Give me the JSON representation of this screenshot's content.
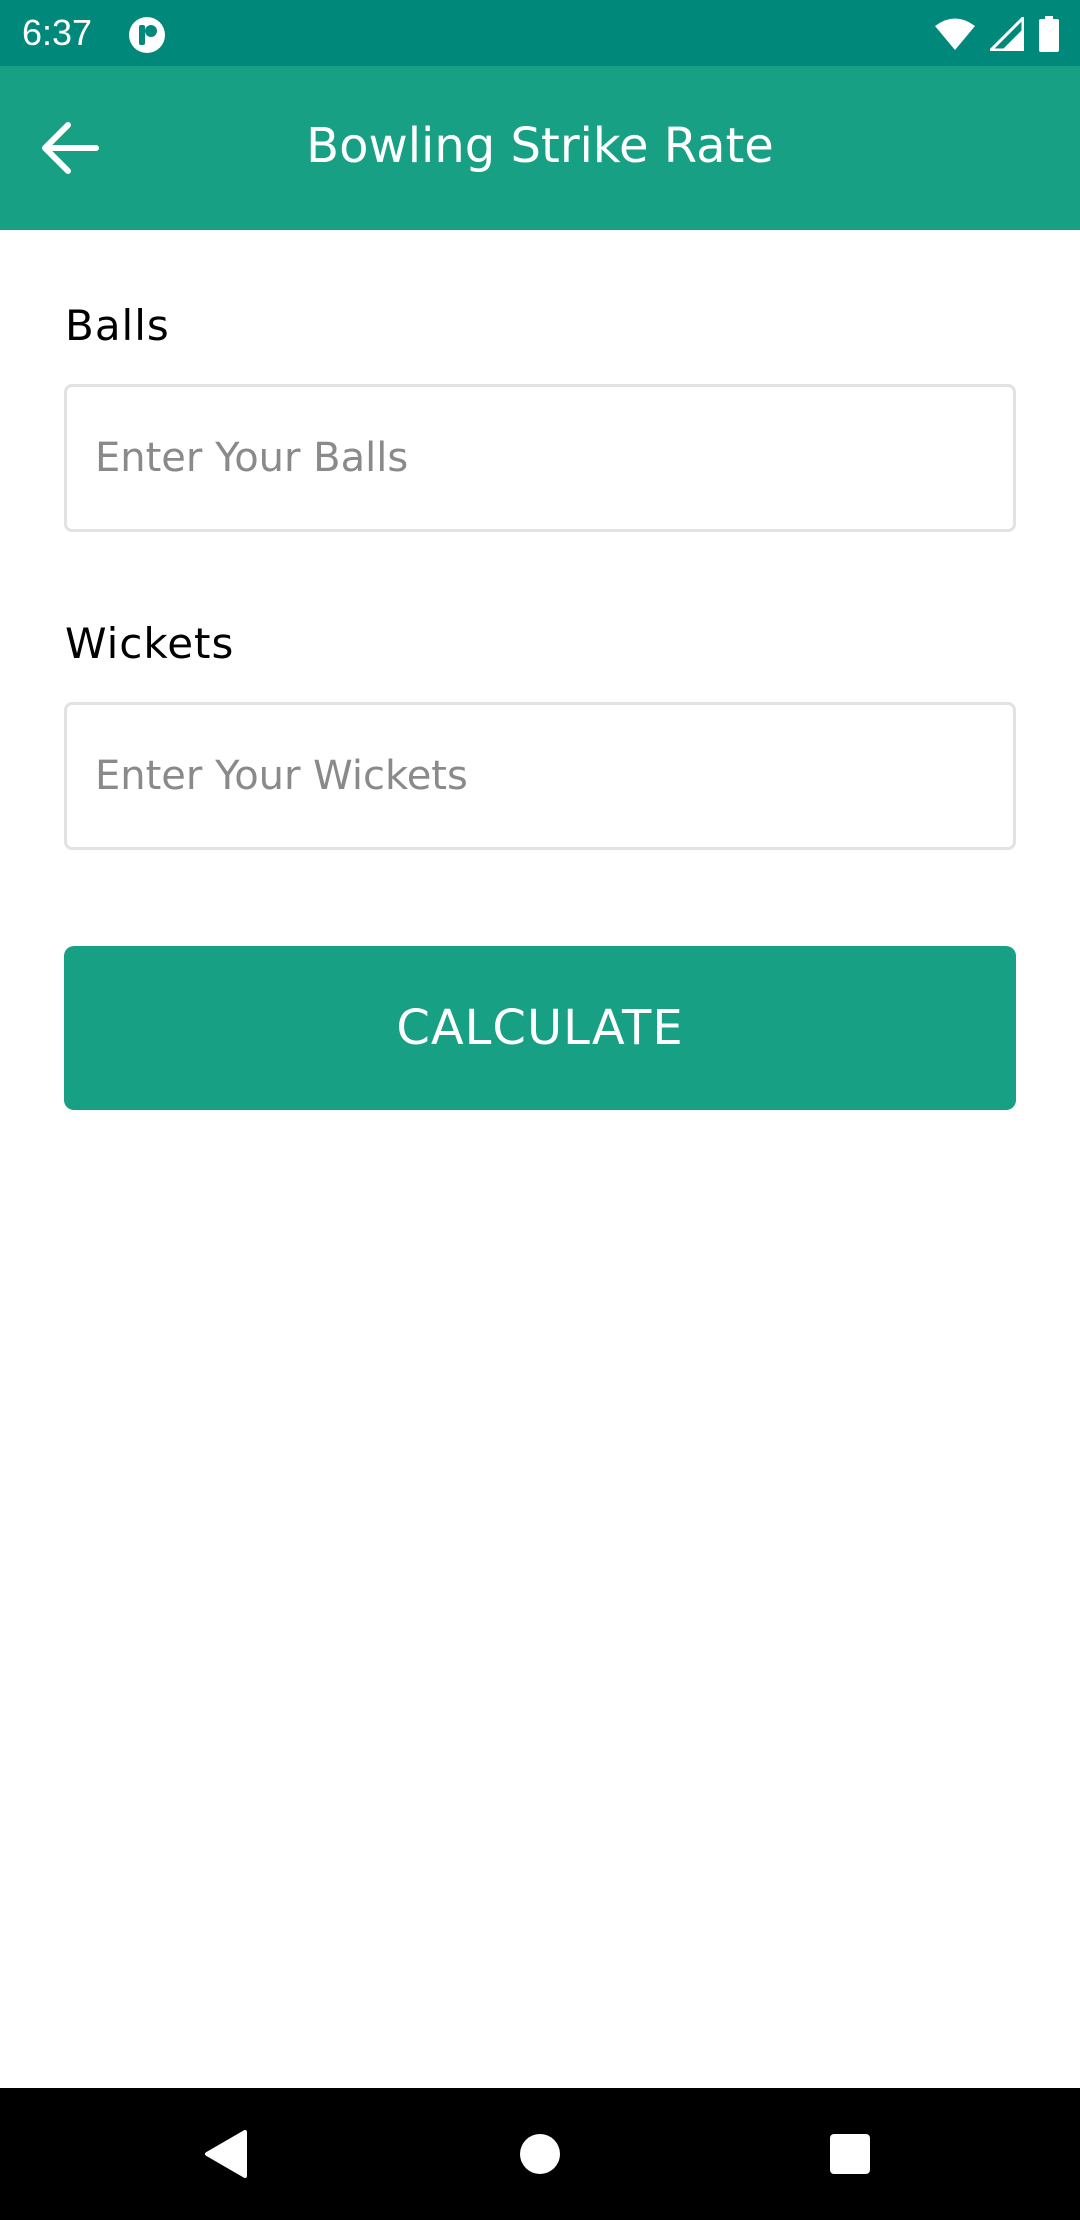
{
  "status_bar": {
    "time": "6:37",
    "icons": [
      "app-notification-icon",
      "wifi-icon",
      "cell-signal-icon",
      "battery-icon"
    ]
  },
  "app_bar": {
    "title": "Bowling Strike Rate",
    "back_icon": "arrow-back-icon"
  },
  "form": {
    "balls": {
      "label": "Balls",
      "placeholder": "Enter Your Balls",
      "value": ""
    },
    "wickets": {
      "label": "Wickets",
      "placeholder": "Enter Your Wickets",
      "value": ""
    },
    "calculate_label": "CALCULATE"
  },
  "nav_bar": {
    "icons": [
      "nav-back-icon",
      "nav-home-icon",
      "nav-recents-icon"
    ]
  },
  "colors": {
    "status_bar": "#00897b",
    "primary": "#17a084",
    "input_border": "#e2e2e2",
    "placeholder": "#8a8a8a",
    "nav_bar": "#000000"
  }
}
